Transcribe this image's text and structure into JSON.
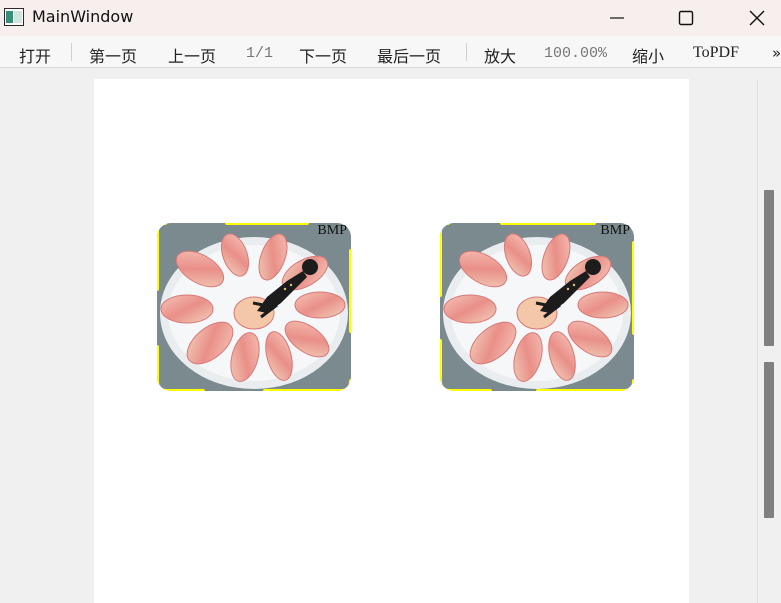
{
  "window": {
    "title": "MainWindow"
  },
  "toolbar": {
    "open": "打开",
    "first_page": "第一页",
    "prev_page": "上一页",
    "page_indicator": "1/1",
    "next_page": "下一页",
    "last_page": "最后一页",
    "zoom_in": "放大",
    "zoom_level": "100.00%",
    "zoom_out": "缩小",
    "to_pdf": "ToPDF",
    "overflow": "»"
  },
  "document": {
    "images": [
      {
        "label": "BMP"
      },
      {
        "label": "BMP"
      }
    ]
  },
  "colors": {
    "frame_accent": "#ffff00",
    "scroll_thumb": "#808080",
    "titlebar_bg": "#f7efed"
  }
}
